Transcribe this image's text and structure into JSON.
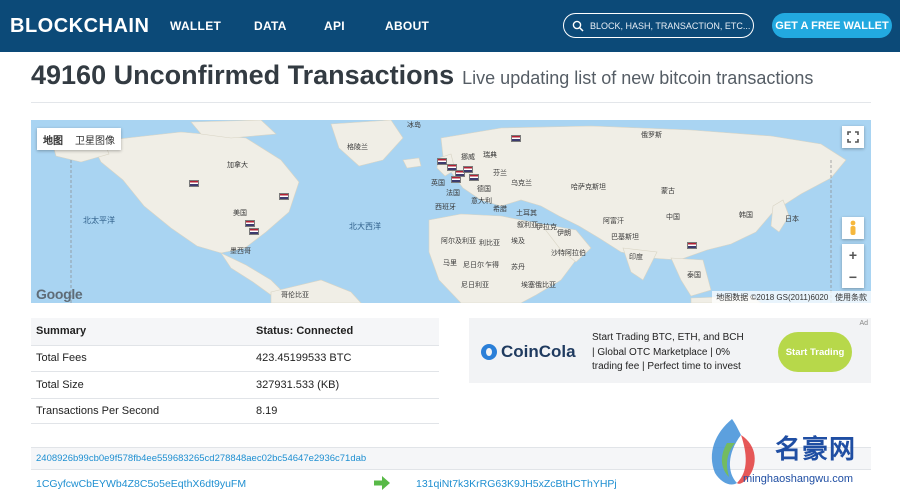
{
  "nav": {
    "logo": "BLOCKCHAIN",
    "links": [
      "WALLET",
      "DATA",
      "API",
      "ABOUT"
    ],
    "search_placeholder": "BLOCK, HASH, TRANSACTION, ETC...",
    "cta": "GET A FREE WALLET"
  },
  "header": {
    "title": "49160 Unconfirmed Transactions",
    "subtitle": "Live updating list of new bitcoin transactions"
  },
  "map": {
    "type_buttons": [
      "地图",
      "卫星图像"
    ],
    "google": "Google",
    "attribution": "地图数据 ©2018 GS(2011)6020",
    "terms": "使用条款",
    "zoom_in": "+",
    "zoom_out": "−",
    "oceans": [
      "北太平洋",
      "北大西洋"
    ],
    "labels": [
      "加拿大",
      "美国",
      "墨西哥",
      "格陵兰",
      "冰岛",
      "英国",
      "挪威",
      "瑞典",
      "芬兰",
      "俄罗斯",
      "乌克兰",
      "法国",
      "德国",
      "西班牙",
      "意大利",
      "希腊",
      "土耳其",
      "伊拉克",
      "伊朗",
      "叙利亚",
      "哈萨克斯坦",
      "蒙古",
      "中国",
      "日本",
      "韩国",
      "印度",
      "泰国",
      "阿尔及利亚",
      "利比亚",
      "埃及",
      "马里",
      "尼日尔",
      "乍得",
      "苏丹",
      "沙特阿拉伯",
      "阿富汗",
      "巴基斯坦",
      "尼日利亚",
      "埃塞俄比亚",
      "哥伦比亚"
    ]
  },
  "summary": {
    "header": {
      "label": "Summary",
      "value": "Status: Connected"
    },
    "rows": [
      {
        "label": "Total Fees",
        "value": "423.45199533 BTC"
      },
      {
        "label": "Total Size",
        "value": "327931.533 (KB)"
      },
      {
        "label": "Transactions Per Second",
        "value": "8.19"
      }
    ]
  },
  "ad": {
    "mark": "Ad",
    "brand": "CoinCola",
    "lines": [
      "Start Trading BTC, ETH, and BCH",
      "| Global OTC Marketplace | 0%",
      "trading fee | Perfect time to invest"
    ],
    "button": "Start Trading"
  },
  "transaction": {
    "hash": "2408926b99cb0e9f578fb4ee559683265cd278848aec02bc54647e2936c71dab",
    "input": "1CGyfcwCbEYWb4Z8C5o5eEqthX6dt9yuFM",
    "output": "131qiNt7k3KrRG63K9JH5xZcBtHCThYHPj"
  },
  "watermark": {
    "cn": "名豪网",
    "en": "minghaoshangwu.com"
  },
  "colors": {
    "nav_bg": "#0c4a78",
    "accent": "#22a9e0",
    "link": "#1e8fd1",
    "ocean": "#a9d4f2",
    "land": "#f0eee6"
  }
}
